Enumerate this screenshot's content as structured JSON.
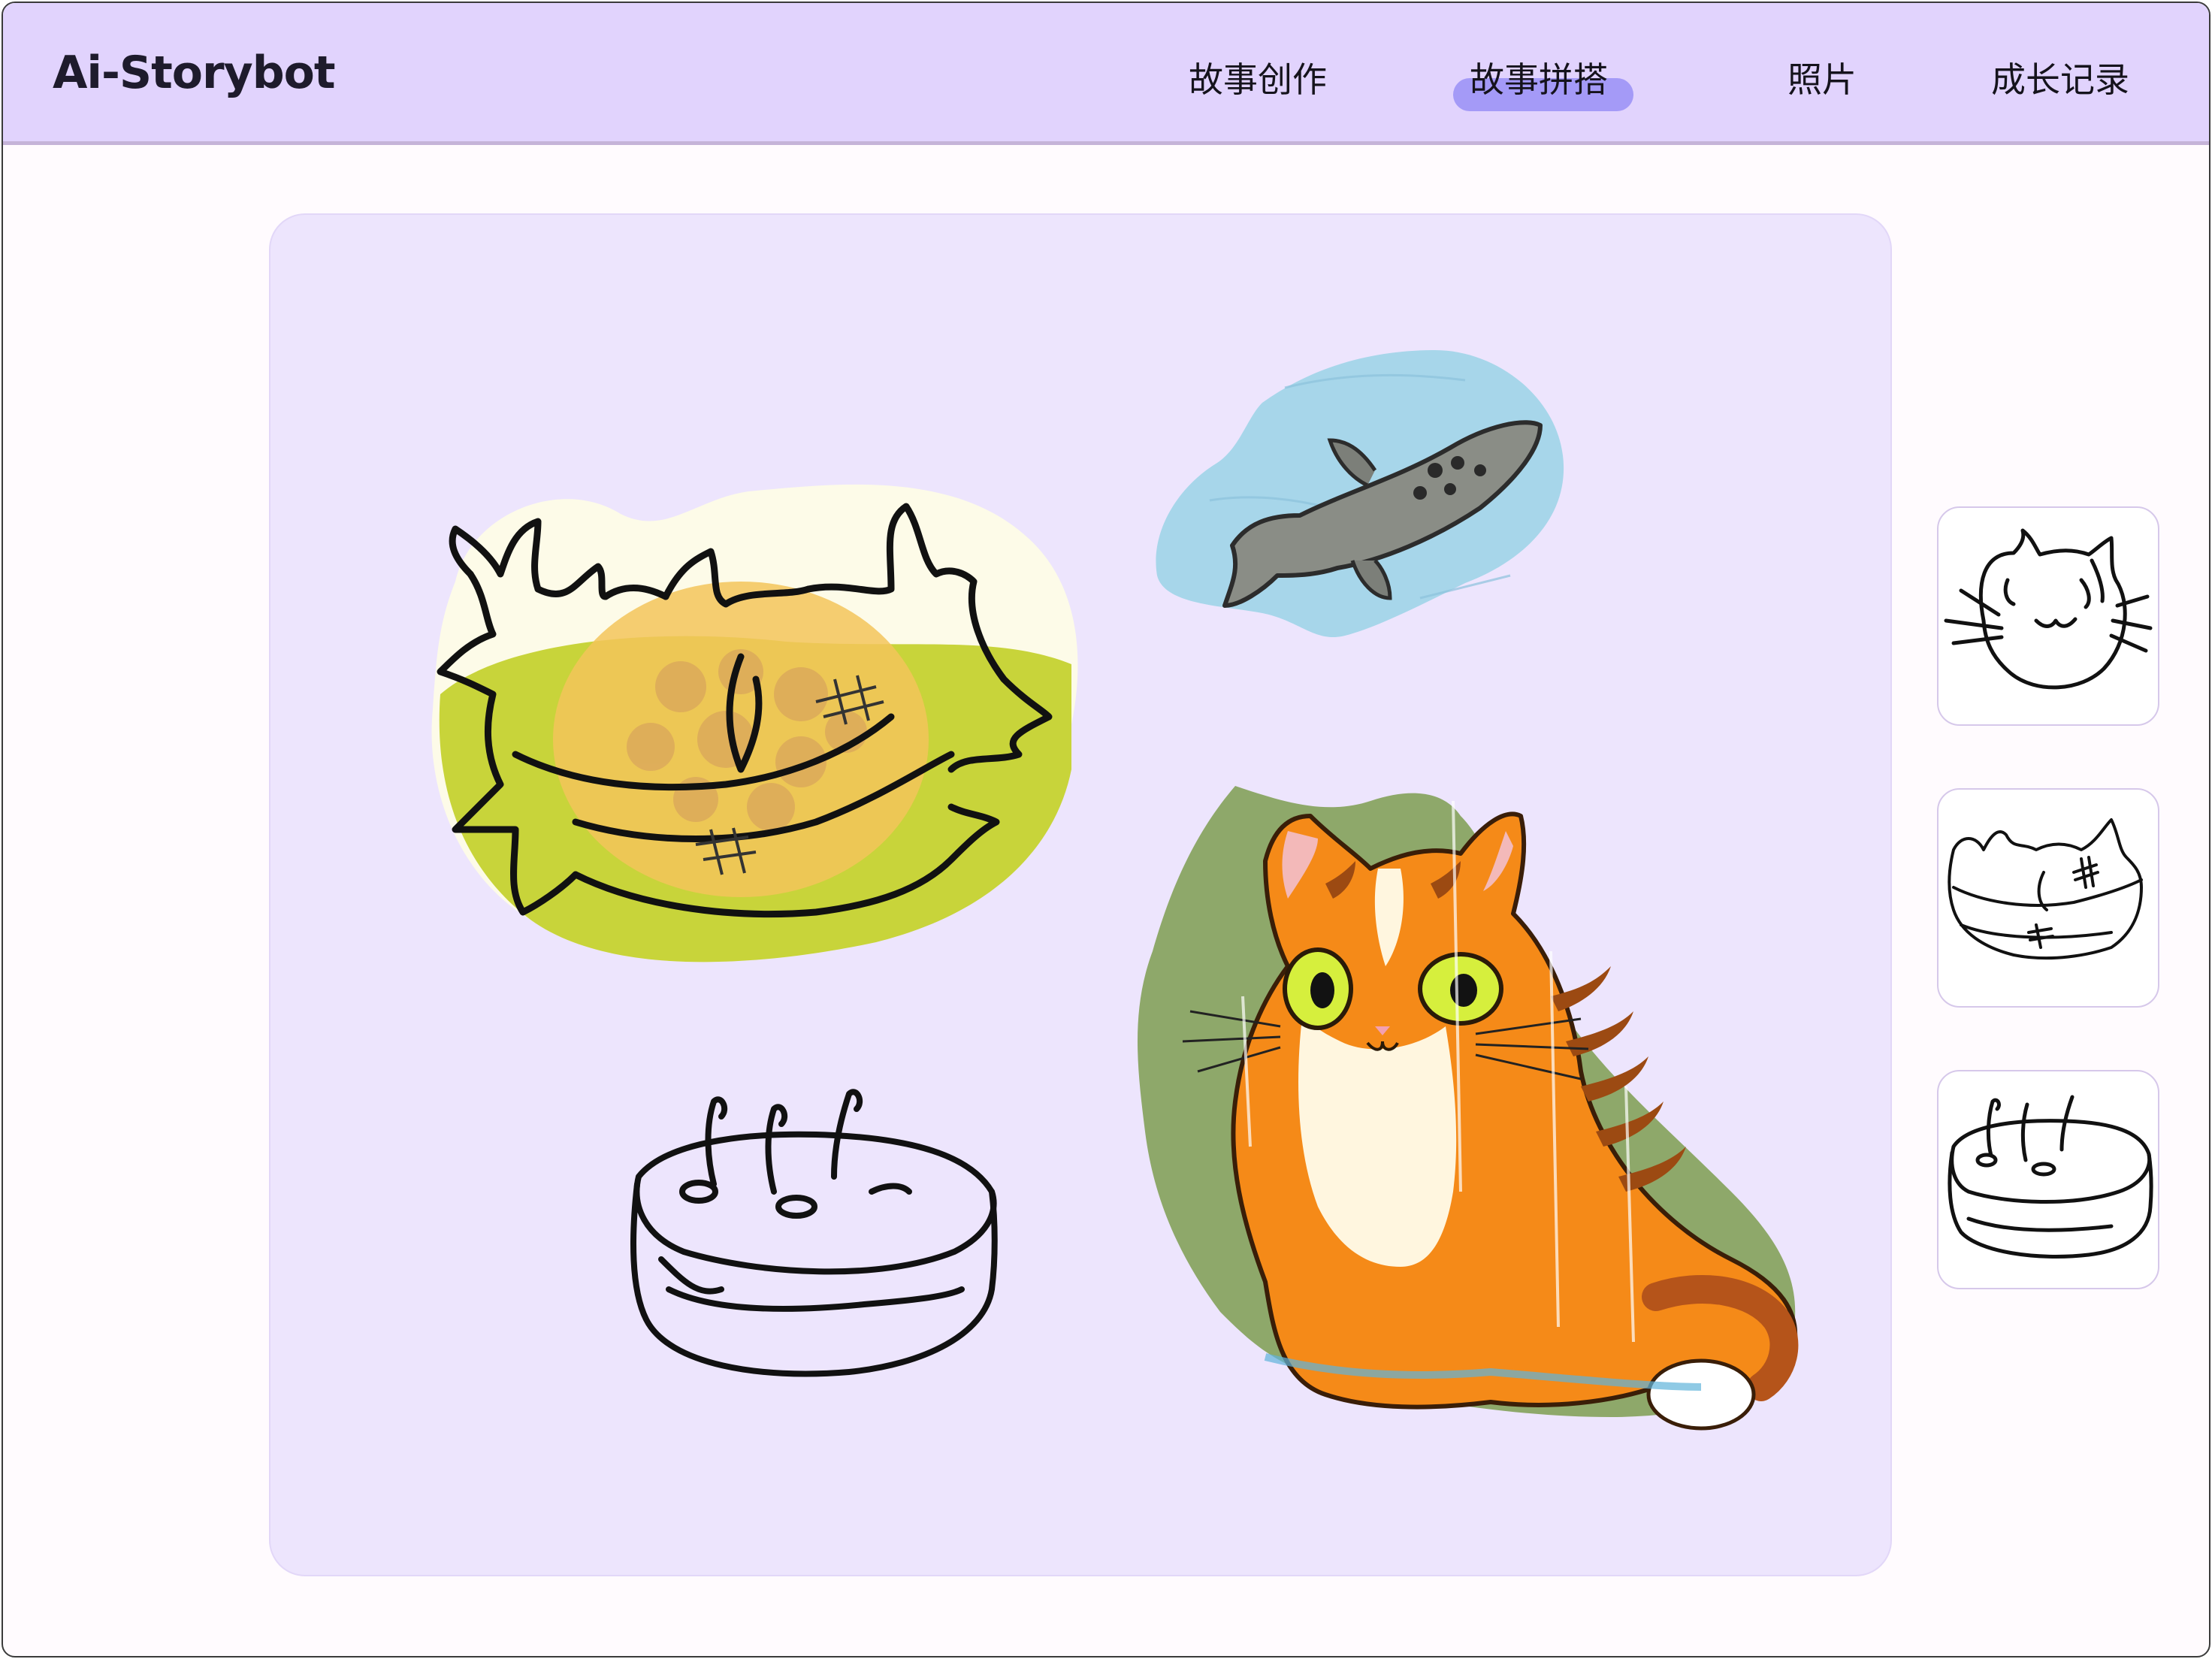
{
  "app": {
    "title": "Ai-Storybot"
  },
  "nav": {
    "items": [
      {
        "label": "故事创作"
      },
      {
        "label": "故事拼搭",
        "active": true
      },
      {
        "label": "照片"
      },
      {
        "label": "成长记录"
      }
    ]
  },
  "canvas": {
    "stickers": [
      {
        "icon": "nest-sticker-icon"
      },
      {
        "icon": "fish-sticker-icon"
      },
      {
        "icon": "cake-sketch-icon"
      },
      {
        "icon": "cat-sticker-icon"
      }
    ]
  },
  "side_panel": {
    "thumbnails": [
      {
        "icon": "cat-face-sketch-icon"
      },
      {
        "icon": "nest-sketch-icon"
      },
      {
        "icon": "cake-sketch-icon"
      }
    ]
  },
  "colors": {
    "header_bg": "#e1d3fd",
    "active_tab_highlight": "#a49af7",
    "canvas_bg": "#ede5fd",
    "page_bg": "#fffbfe"
  }
}
